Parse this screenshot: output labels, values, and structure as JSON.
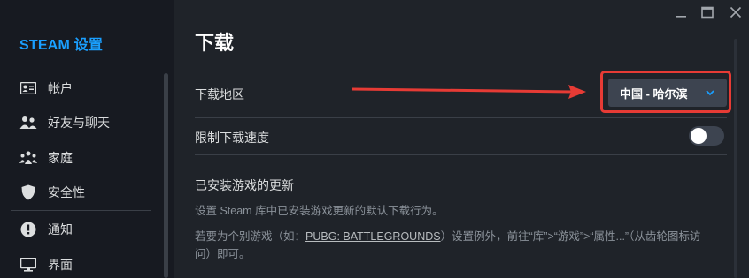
{
  "sidebar": {
    "title": "STEAM 设置",
    "items": [
      {
        "label": "帐户",
        "icon": "account-card-icon"
      },
      {
        "label": "好友与聊天",
        "icon": "friends-icon"
      },
      {
        "label": "家庭",
        "icon": "family-icon"
      },
      {
        "label": "安全性",
        "icon": "shield-icon"
      },
      {
        "label": "通知",
        "icon": "alert-icon"
      },
      {
        "label": "界面",
        "icon": "monitor-icon"
      }
    ]
  },
  "window": {
    "minimize_icon": "minimize-icon",
    "maximize_icon": "maximize-icon",
    "close_icon": "close-icon"
  },
  "main": {
    "title": "下载",
    "download_region": {
      "label": "下载地区",
      "value": "中国 - 哈尔滨"
    },
    "limit_speed": {
      "label": "限制下载速度",
      "enabled": false
    },
    "updates_section": {
      "heading": "已安装游戏的更新",
      "description": "设置 Steam 库中已安装游戏更新的默认下载行为。",
      "note_prefix": "若要为个别游戏（如：",
      "note_link": "PUBG: BATTLEGROUNDS",
      "note_suffix": "）设置例外，前往“库”>“游戏”>“属性...”（从齿轮图标访",
      "note_line2": "问）即可。"
    }
  },
  "colors": {
    "accent": "#1a9fff",
    "annotation": "#e63b35",
    "background": "#1f2329",
    "sidebar": "#171a21"
  }
}
